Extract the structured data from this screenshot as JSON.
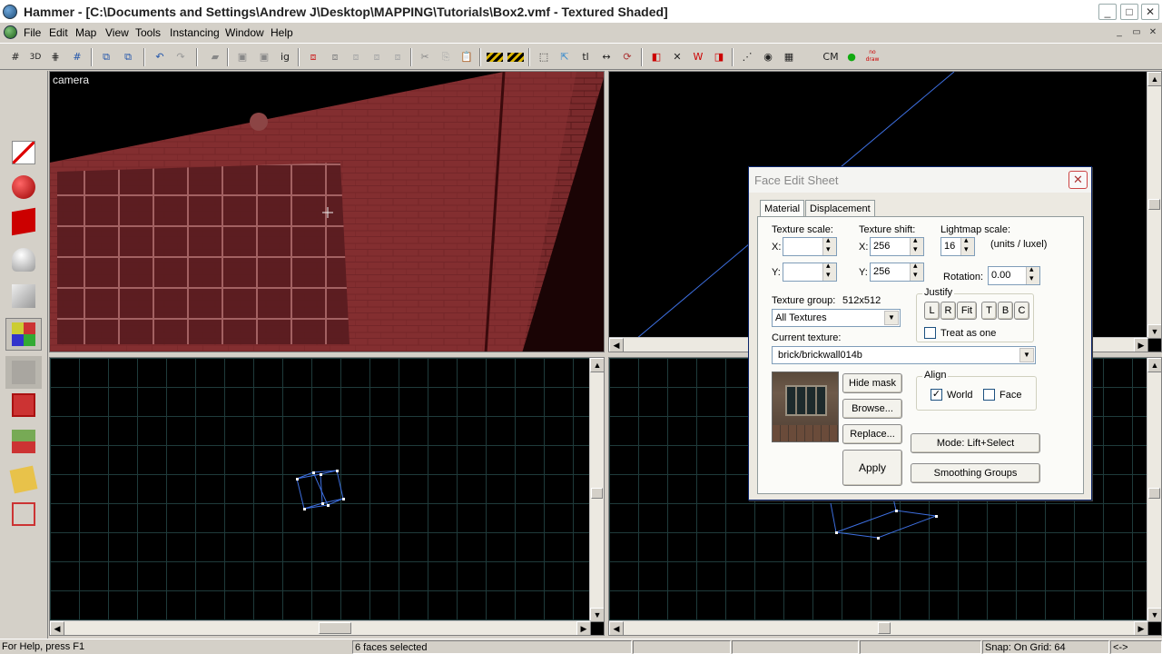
{
  "window": {
    "title": "Hammer - [C:\\Documents and Settings\\Andrew J\\Desktop\\MAPPING\\Tutorials\\Box2.vmf - Textured Shaded]",
    "minimize": "_",
    "maximize": "□",
    "close": "✕"
  },
  "menu": {
    "items": [
      "File",
      "Edit",
      "Map",
      "View",
      "Tools",
      "Instancing",
      "Window",
      "Help"
    ],
    "mdi_controls": [
      "_",
      "▭",
      "✕"
    ]
  },
  "toolbar": {
    "icons": [
      "grid-toggle-icon",
      "grid-3d-icon",
      "grid-dots-icon",
      "grid-add-icon",
      "group-icon",
      "ungroup-icon",
      "undo-icon",
      "redo-icon",
      "carve-icon",
      "hide-icon",
      "show-icon",
      "ignore-groups-icon",
      "cordon-icon",
      "texture-lock-icon",
      "texture-scale-lock-icon",
      "autoselect-icon",
      "cut-icon",
      "copy-icon",
      "paste-icon",
      "hide-items-icon",
      "show-items-icon",
      "selection-box-icon",
      "select-cursor-icon",
      "toggle-text-icon",
      "move-arrows-icon",
      "rotate-icon",
      "vertex-icon",
      "dimension-icon",
      "wireframe-icon",
      "displace-icon",
      "entity-report-icon",
      "clip-icon",
      "sphere-icon",
      "wm-icon",
      "cm-icon",
      "check-icon",
      "nodraw-icon"
    ],
    "labels": {
      "ignore_groups": "ig",
      "toggle_text": "tl",
      "cm": "CM",
      "nodraw": "no draw"
    }
  },
  "palette": {
    "tools": [
      "selection-tool-icon",
      "magnify-tool-icon",
      "camera-tool-icon",
      "entity-tool-icon",
      "block-tool-icon",
      "texture-app-icon",
      "apply-decal-icon",
      "overlay-icon",
      "clipping-tool-icon",
      "vertex-tool-icon",
      "path-tool-icon",
      "sprinkle-tool-icon"
    ]
  },
  "viewports": {
    "camera_label": "camera"
  },
  "face_edit": {
    "title": "Face Edit Sheet",
    "close": "✕",
    "tabs": [
      "Material",
      "Displacement"
    ],
    "texture_scale_label": "Texture scale:",
    "texture_shift_label": "Texture shift:",
    "lightmap_scale_label": "Lightmap scale:",
    "x_label": "X:",
    "y_label": "Y:",
    "scale_x": "",
    "scale_y": "",
    "shift_x": "256",
    "shift_y": "256",
    "lightmap_value": "16",
    "units_label": "(units / luxel)",
    "rotation_label": "Rotation:",
    "rotation_value": "0.00",
    "texture_group_label": "Texture group:",
    "texture_group_size": "512x512",
    "texture_group_value": "All Textures",
    "justify_label": "Justify",
    "justify_buttons": [
      "L",
      "R",
      "Fit",
      "T",
      "B",
      "C"
    ],
    "treat_as_one": "Treat as one",
    "treat_as_one_checked": false,
    "current_texture_label": "Current texture:",
    "current_texture": "brick/brickwall014b",
    "hide_mask": "Hide mask",
    "browse": "Browse...",
    "replace": "Replace...",
    "apply": "Apply",
    "align_label": "Align",
    "align_world": "World",
    "align_world_checked": true,
    "align_face": "Face",
    "align_face_checked": false,
    "mode": "Mode: Lift+Select",
    "smoothing_groups": "Smoothing Groups"
  },
  "status": {
    "help": "For Help, press F1",
    "selection": "6 faces selected",
    "snap": "Snap: On Grid: 64",
    "extra": "<->"
  },
  "colors": {
    "viewport_bg": "#000000",
    "grid_line": "#1f3b3b",
    "wire": "#3d6fe0",
    "dialog_border": "#0a246a"
  }
}
